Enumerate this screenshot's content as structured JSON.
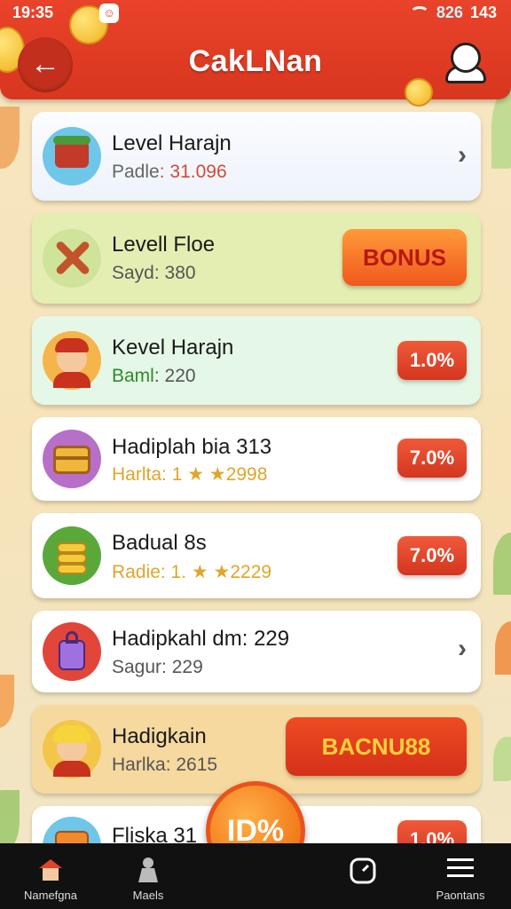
{
  "status_bar": {
    "time": "19:35",
    "network": "826",
    "battery": "143"
  },
  "header": {
    "title": "CakLNan",
    "back_icon": "back-arrow-icon",
    "profile_icon": "profile-icon"
  },
  "items": [
    {
      "title": "Level Harajn",
      "label": "Padle",
      "value": ": 31.096",
      "action": {
        "type": "chevron",
        "label": "›"
      },
      "icon": "market-cart-icon",
      "sub_color": "#d14a36"
    },
    {
      "title": "Levell Floe",
      "label": "Sayd",
      "value": ": 380",
      "action": {
        "type": "bonus",
        "label": "BONUS"
      },
      "icon": "crossed-tools-icon",
      "sub_color": "#555555"
    },
    {
      "title": "Kevel Harajn",
      "label": "Baml",
      "value": ": 220",
      "action": {
        "type": "percent",
        "label": "1.0%"
      },
      "icon": "boy-avatar-icon",
      "sub_color": "#2e8b2e"
    },
    {
      "title": "Hadiplah bia 313",
      "label": "Harlta",
      "value": ": 1 ★ ★2998",
      "action": {
        "type": "percent",
        "label": "7.0%"
      },
      "icon": "treasure-chest-icon",
      "sub_color": "#e0a52a"
    },
    {
      "title": "Badual 8s",
      "label": "Radie",
      "value": ": 1. ★ ★2229",
      "action": {
        "type": "percent",
        "label": "7.0%"
      },
      "icon": "coin-stack-icon",
      "sub_color": "#e0a52a"
    },
    {
      "title": "Hadipkahl dm: 229",
      "label": "Sagur",
      "value": ": 229",
      "action": {
        "type": "chevron",
        "label": "›"
      },
      "icon": "purple-bag-icon",
      "sub_color": "#555555"
    },
    {
      "title": "Hadigkain",
      "label": "Harlka",
      "value": ": 2615",
      "action": {
        "type": "bacnus",
        "label": "BACNU88"
      },
      "icon": "girl-avatar-icon",
      "sub_color": "#555555"
    },
    {
      "title": "Fliska 31",
      "label": "",
      "value": "",
      "action": {
        "type": "percent",
        "label": "1.0%"
      },
      "icon": "box-icon",
      "sub_color": "#555555"
    }
  ],
  "fab": {
    "label": "ID%"
  },
  "bottom_nav": [
    {
      "label": "Namefgna",
      "icon": "home-icon"
    },
    {
      "label": "Maels",
      "icon": "person-icon"
    },
    {
      "label": "",
      "icon": "timer-icon"
    },
    {
      "label": "Paontans",
      "icon": "menu-icon"
    }
  ],
  "colors": {
    "header": "#e3402a",
    "accent": "#f27a1a",
    "nav_bg": "#111111"
  }
}
